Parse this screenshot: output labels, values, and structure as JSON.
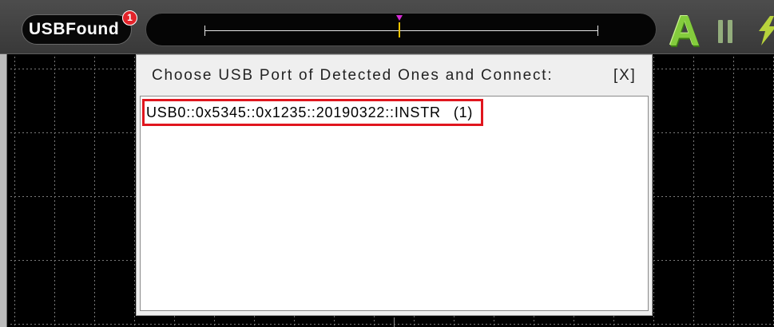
{
  "toolbar": {
    "usb_found": {
      "label": "USBFound",
      "badge": "1"
    },
    "auto_button": {
      "label": "A"
    },
    "icons": {
      "pause": "pause-icon",
      "lightning": "lightning-icon",
      "trigger_marker": "triangle-down-icon"
    }
  },
  "dialog": {
    "title": "Choose USB Port of Detected Ones and Connect:",
    "close_label": "[X]",
    "ports": [
      {
        "address": "USB0::0x5345::0x1235::20190322::INSTR",
        "index": "(1)"
      }
    ]
  },
  "colors": {
    "toolbar_background": "#3f3f3f",
    "scope_background": "#000000",
    "grid_dots": "#7a7a7a",
    "badge_red": "#e3232a",
    "auto_green": "#84cc3d",
    "pause_green": "#93ad7c",
    "lightning_yellow_green": "#b8d33c",
    "trigger_magenta": "#d42ad4",
    "trigger_yellow": "#f0c400",
    "highlight_red": "#e0161e",
    "dialog_background": "#efefef"
  }
}
